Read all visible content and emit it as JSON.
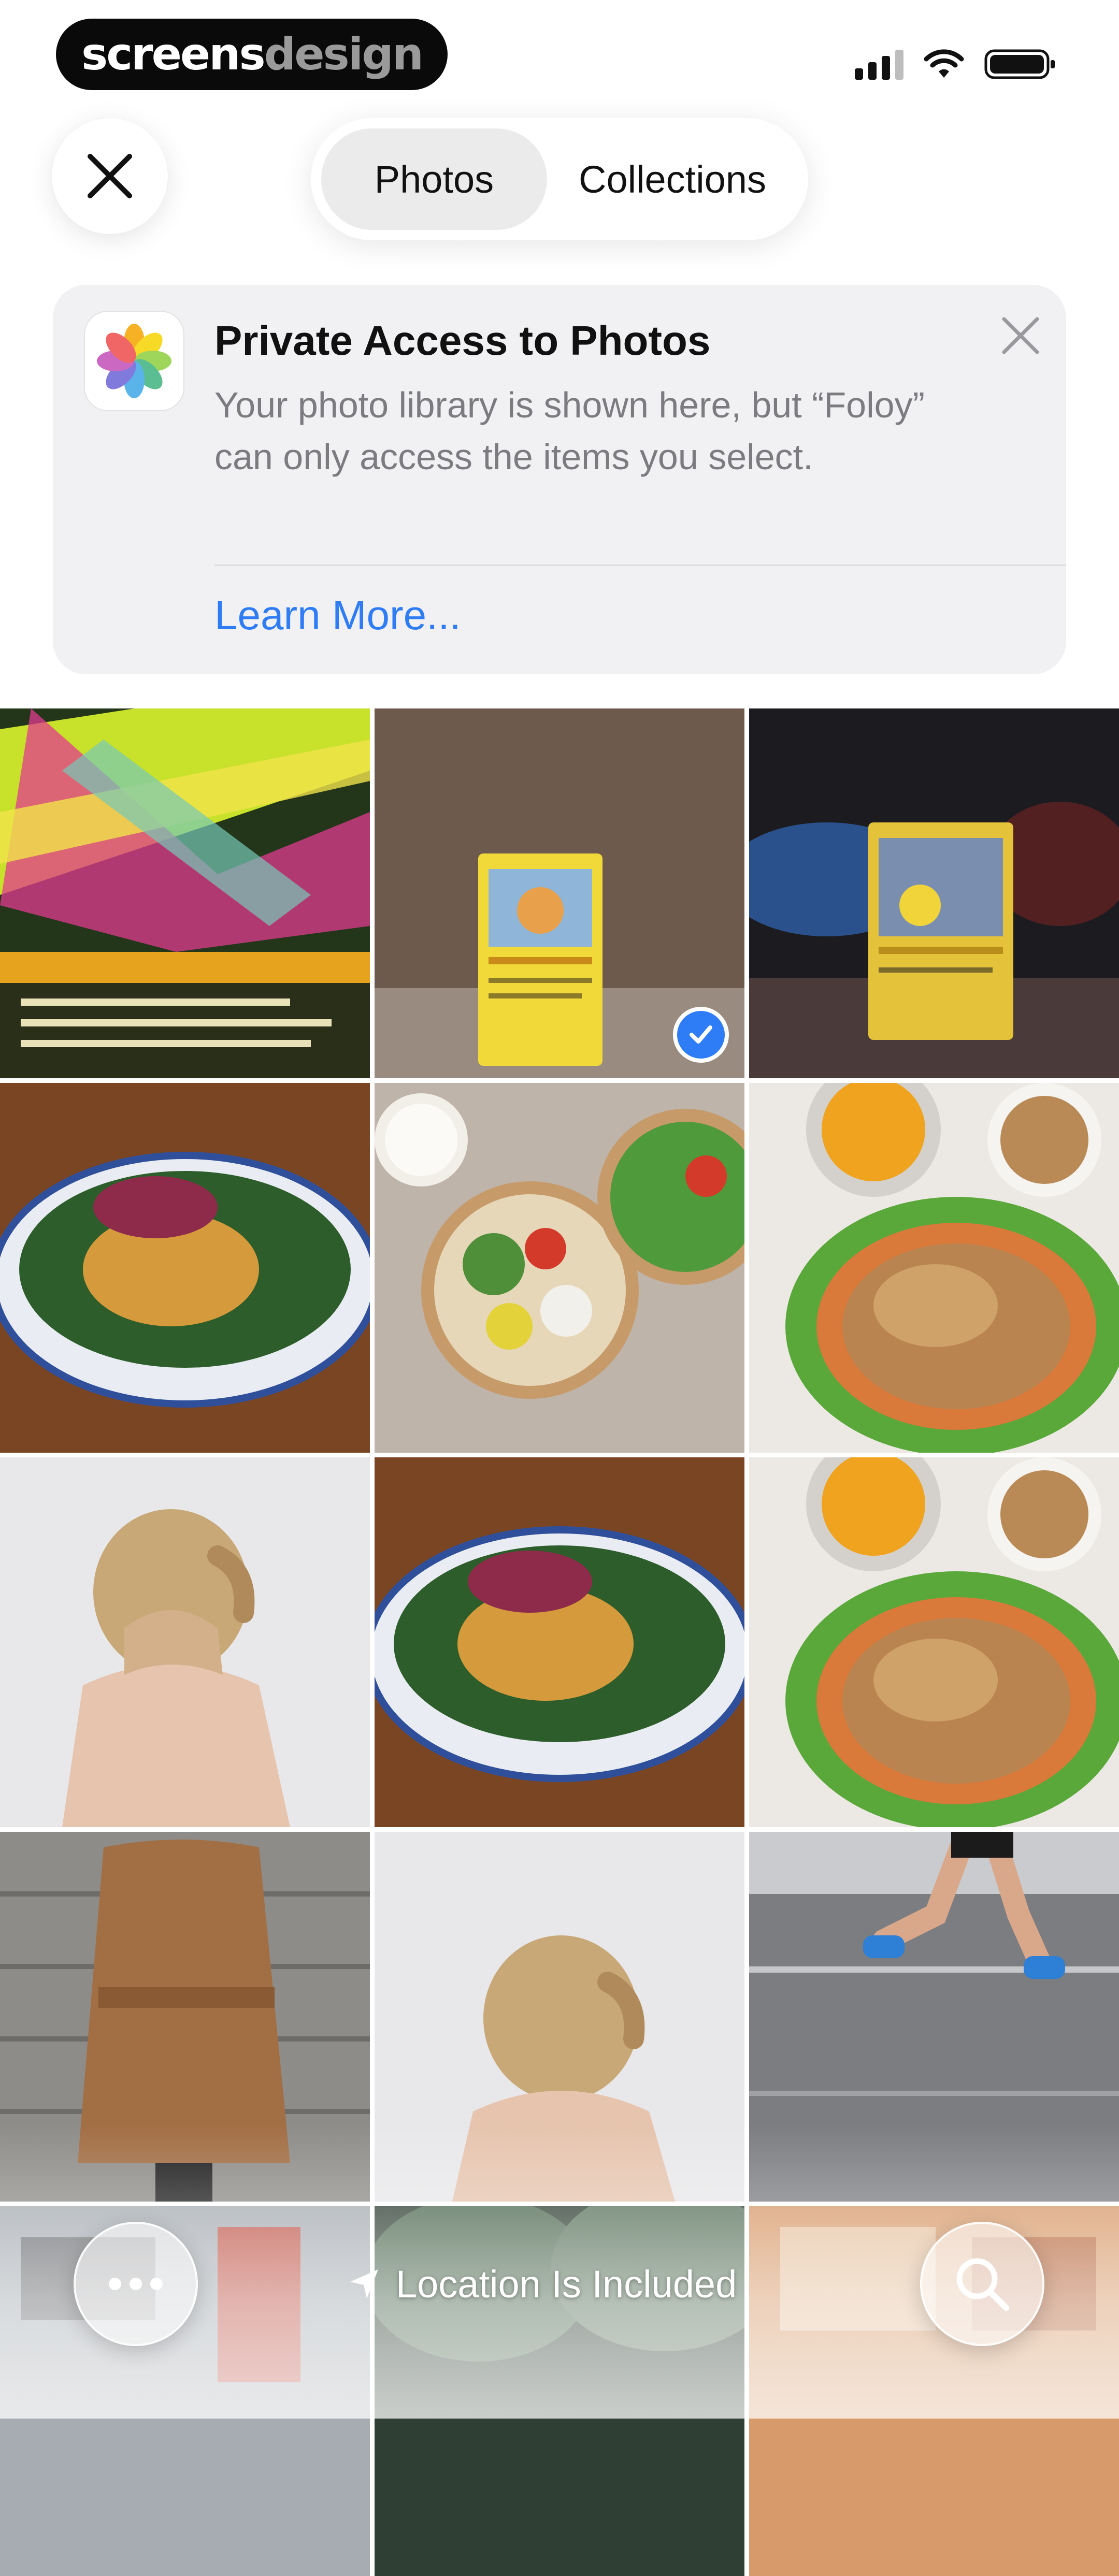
{
  "watermark": {
    "part1": "screens",
    "part2": "design"
  },
  "status": {
    "signal": "signal-icon",
    "wifi": "wifi-icon",
    "battery": "battery-icon"
  },
  "top": {
    "close_icon": "close-icon",
    "tabs": [
      {
        "label": "Photos",
        "selected": true
      },
      {
        "label": "Collections",
        "selected": false
      }
    ]
  },
  "banner": {
    "app_icon": "photos-app-icon",
    "title": "Private Access to Photos",
    "body": "Your photo library is shown here, but “Foloy” can only access the items you select.",
    "link": "Learn More...",
    "dismiss_icon": "close-icon"
  },
  "photos": [
    {
      "subject": "pokemon card close-up",
      "selected": false
    },
    {
      "subject": "raichu card on table",
      "selected": true
    },
    {
      "subject": "pikachu card dark background",
      "selected": false
    },
    {
      "subject": "salad bowl with curry",
      "selected": false
    },
    {
      "subject": "poke bowl with vegetables",
      "selected": false
    },
    {
      "subject": "roast chicken with soup",
      "selected": false
    },
    {
      "subject": "woman bare back",
      "selected": false
    },
    {
      "subject": "salad bowl with curry",
      "selected": false
    },
    {
      "subject": "roast chicken with soup",
      "selected": false
    },
    {
      "subject": "woman in brown coat",
      "selected": false
    },
    {
      "subject": "woman bare back",
      "selected": false
    },
    {
      "subject": "runner legs on road",
      "selected": false
    },
    {
      "subject": "street sign",
      "selected": false
    },
    {
      "subject": "trees",
      "selected": false
    },
    {
      "subject": "orange shop",
      "selected": false
    }
  ],
  "bottom": {
    "more_icon": "ellipsis-icon",
    "location_icon": "location-arrow-icon",
    "location_label": "Location Is Included",
    "search_icon": "search-icon"
  },
  "colors": {
    "accent": "#2e7cf6",
    "banner_bg": "#f1f1f3",
    "muted_text": "#7b7b80"
  }
}
